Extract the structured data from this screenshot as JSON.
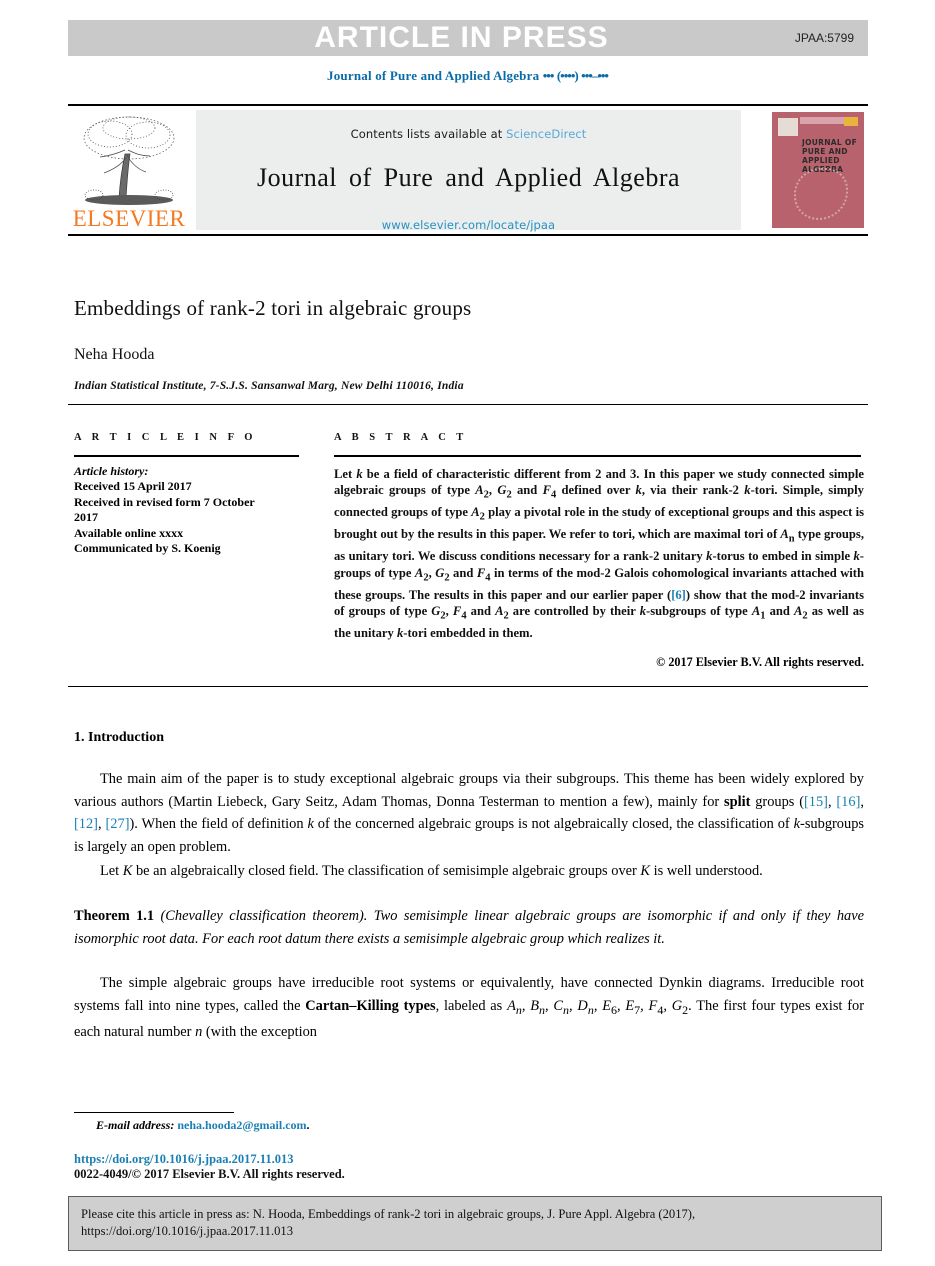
{
  "banner": {
    "headline": "ARTICLE IN PRESS",
    "article_code": "JPAA:5799"
  },
  "running_head": {
    "journal": "Journal of Pure and Applied Algebra",
    "volume_placeholder": "•••",
    "year_placeholder": "(••••)",
    "pages_placeholder": "•••–•••"
  },
  "masthead": {
    "contents_prefix": "Contents lists available at ",
    "contents_link": "ScienceDirect",
    "journal_title": "Journal of Pure and Applied Algebra",
    "journal_url": "www.elsevier.com/locate/jpaa",
    "publisher_logo_text": "ELSEVIER",
    "cover_title": "JOURNAL OF\nPURE AND\nAPPLIED ALGEBRA"
  },
  "article": {
    "title": "Embeddings of rank-2 tori in algebraic groups",
    "author": "Neha Hooda",
    "affiliation": "Indian Statistical Institute, 7-S.J.S. Sansanwal Marg, New Delhi 110016, India"
  },
  "info": {
    "heading": "A R T I C L E   I N F O",
    "history_label": "Article history:",
    "history": [
      "Received 15 April 2017",
      "Received in revised form 7 October",
      "2017",
      "Available online xxxx",
      "Communicated by S. Koenig"
    ]
  },
  "abstract": {
    "heading": "A B S T R A C T",
    "paragraph_html": "Let <i>k</i> be a field of characteristic different from 2 and 3. In this paper we study connected simple algebraic groups of type <i>A</i><sub>2</sub>, <i>G</i><sub>2</sub> and <i>F</i><sub>4</sub> defined over <i>k</i>, via their rank-2 <i>k</i>-tori. Simple, simply connected groups of type <i>A</i><sub>2</sub> play a pivotal role in the study of exceptional groups and this aspect is brought out by the results in this paper. We refer to tori, which are maximal tori of <i>A</i><sub>n</sub> type groups, as unitary tori. We discuss conditions necessary for a rank-2 unitary <i>k</i>-torus to embed in simple <i>k</i>-groups of type <i>A</i><sub>2</sub>, <i>G</i><sub>2</sub> and <i>F</i><sub>4</sub> in terms of the mod-2 Galois cohomological invariants attached with these groups. The results in this paper and our earlier paper (<span class=\"ref\">[6]</span>) show that the mod-2 invariants of groups of type <i>G</i><sub>2</sub>, <i>F</i><sub>4</sub> and <i>A</i><sub>2</sub> are controlled by their <i>k</i>-subgroups of type <i>A</i><sub>1</sub> and <i>A</i><sub>2</sub> as well as the unitary <i>k</i>-tori embedded in them.",
    "copyright": "© 2017 Elsevier B.V. All rights reserved."
  },
  "body": {
    "section_heading": "1. Introduction",
    "paragraph_1_html": "The main aim of the paper is to study exceptional algebraic groups via their subgroups. This theme has been widely explored by various authors (Martin Liebeck, Gary Seitz, Adam Thomas, Donna Testerman to mention a few), mainly for <b>split</b> groups (<span class=\"ref\">[15]</span>, <span class=\"ref\">[16]</span>, <span class=\"ref\">[12]</span>, <span class=\"ref\">[27]</span>). When the field of definition <i>k</i> of the concerned algebraic groups is not algebraically closed, the classification of <i>k</i>-subgroups is largely an open problem.",
    "paragraph_2_html": "Let <i>K</i> be an algebraically closed field. The classification of semisimple algebraic groups over <i>K</i> is well understood.",
    "theorem_label": "Theorem 1.1",
    "theorem_html": "<b class=\"thmname\">Theorem 1.1</b> <i>(Chevalley classification theorem). Two semisimple linear algebraic groups are isomorphic if and only if they have isomorphic root data. For each root datum there exists a semisimple algebraic group which realizes it.</i>",
    "paragraph_3_html": "The simple algebraic groups have irreducible root systems or equivalently, have connected Dynkin diagrams. Irreducible root systems fall into nine types, called the <b>Cartan–Killing types</b>, labeled as <i>A<sub>n</sub>, B<sub>n</sub>, C<sub>n</sub>, D<sub>n</sub>, E</i><sub>6</sub><i>, E</i><sub>7</sub><i>, F</i><sub>4</sub><i>, G</i><sub>2</sub>. The first four types exist for each natural number <i>n</i> (with the exception"
  },
  "footnote": {
    "email_label": "E-mail address:",
    "email": "neha.hooda2@gmail.com",
    "email_suffix": ".",
    "doi": "https://doi.org/10.1016/j.jpaa.2017.11.013",
    "issn_copyright": "0022-4049/© 2017 Elsevier B.V. All rights reserved."
  },
  "cite_box": {
    "line1": "Please cite this article in press as: N. Hooda, Embeddings of rank-2 tori in algebraic groups, J. Pure Appl. Algebra (2017),",
    "line2": "https://doi.org/10.1016/j.jpaa.2017.11.013"
  },
  "colors": {
    "banner_bg": "#c9c9c9",
    "link_blue": "#1a7fb5",
    "sciencedirect_blue": "#5aa7d6",
    "elsevier_orange": "#f47920",
    "cover_rose": "#b8626d",
    "cite_box_bg": "#cfcfcf"
  }
}
